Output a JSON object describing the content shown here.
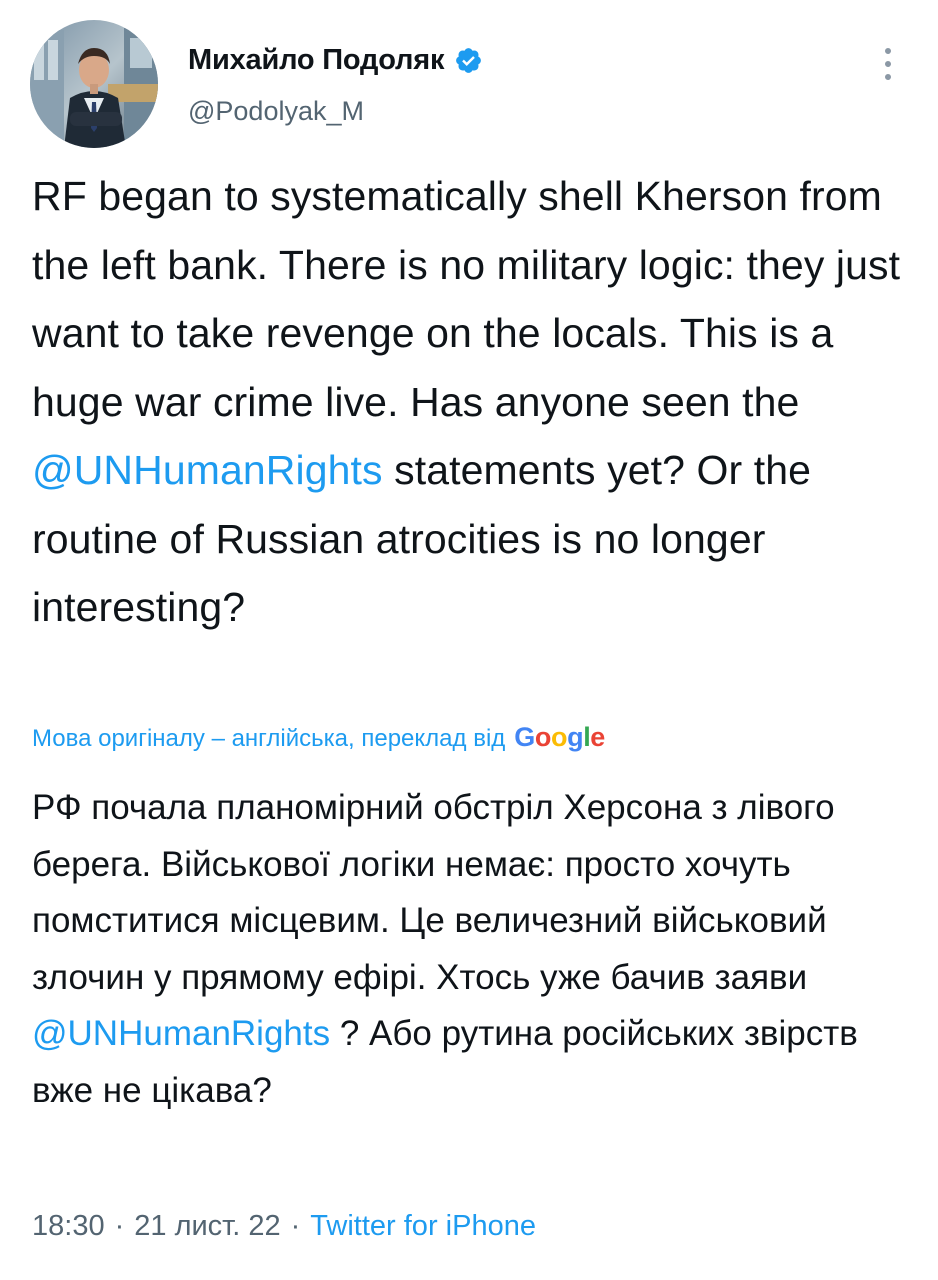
{
  "author": {
    "name": "Михайло Подоляк",
    "handle": "@Podolyak_M",
    "verified": true
  },
  "tweet": {
    "text_before_mention": "RF began to systematically shell Kherson from the left bank. There is no military logic: they just want to take revenge on the locals. This is a huge war crime live. Has anyone seen the ",
    "mention": "@UNHumanRights",
    "text_after_mention": " statements yet? Or the routine of Russian atrocities is no longer interesting?"
  },
  "translation": {
    "notice": "Мова оригіналу – англійська, переклад від",
    "provider_logo": "Google",
    "text_before_mention": "РФ почала планомірний обстріл Херсона з лівого берега. Військової логіки немає: просто хочуть помститися місцевим. Це величезний військовий злочин у прямому ефірі. Хтось уже бачив заяви ",
    "mention": "@UNHumanRights",
    "text_after_mention": " ? Або рутина російських звірств вже не цікава?"
  },
  "meta": {
    "time": "18:30",
    "separator": "·",
    "date": "21 лист. 22",
    "source": "Twitter for iPhone"
  },
  "icons": {
    "more": "more-vertical-icon",
    "verified": "verified-badge-icon"
  },
  "colors": {
    "accent": "#1d9bf0",
    "text": "#0f1419",
    "secondary": "#536471"
  }
}
